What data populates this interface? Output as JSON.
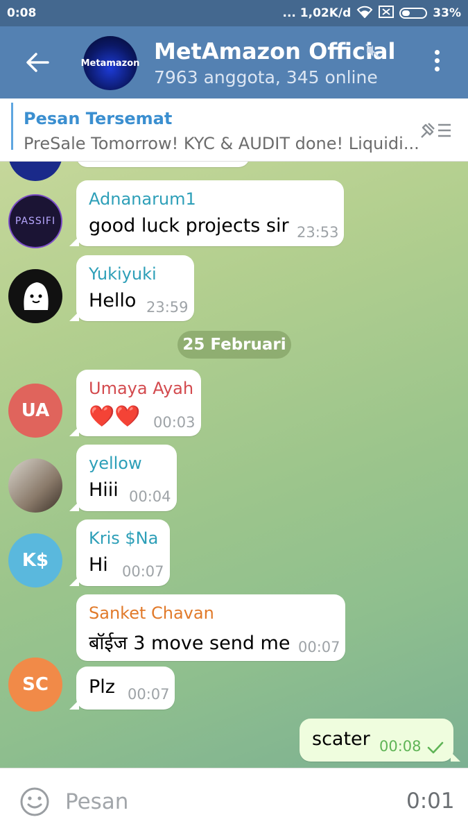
{
  "status_bar": {
    "time": "0:08",
    "network_speed": "... 1,02K/d",
    "battery_percent": "33%",
    "battery_level": 0.33
  },
  "header": {
    "title": "MetAmazon Official",
    "subtitle": "7963 anggota, 345 online",
    "avatar_text": "Metamazon",
    "muted": true
  },
  "pinned": {
    "title": "Pesan Tersemat",
    "text": "PreSale Tomorrow! KYC & AUDIT done! Liquidi..."
  },
  "date_separator": "25 Februari",
  "colors": {
    "header_bg": "#5481b2",
    "statusbar_bg": "#44688f",
    "pinned_title": "#3b8fd0",
    "outgoing_bubble": "#effdde",
    "check": "#5fb456"
  },
  "messages": [
    {
      "sender": "Adnanarum1",
      "sender_color": "#2d9fb8",
      "text": "good luck projects sir",
      "time": "23:53",
      "avatar_text": "PASSIFI"
    },
    {
      "sender": "Yukiyuki",
      "sender_color": "#2d9fb8",
      "text": "Hello",
      "time": "23:59",
      "avatar_text": ""
    },
    {
      "sender": "Umaya Ayah",
      "sender_color": "#d34a4e",
      "text": "❤️❤️",
      "time": "00:03",
      "avatar_text": "UA",
      "avatar_color": "#e0645c"
    },
    {
      "sender": "yellow",
      "sender_color": "#2d9fb8",
      "text": "Hiii",
      "time": "00:04",
      "avatar_text": ""
    },
    {
      "sender": "Kris $Na",
      "sender_color": "#2d9fb8",
      "text": "Hi",
      "time": "00:07",
      "avatar_text": "K$",
      "avatar_color": "#5ab8dd"
    },
    {
      "sender": "Sanket Chavan",
      "sender_color": "#e17a2a",
      "text": "बॉईज 3 move send me",
      "time": "00:07",
      "avatar_text": "SC",
      "avatar_color": "#f18a48"
    },
    {
      "sender": "",
      "text": "Plz",
      "time": "00:07"
    }
  ],
  "outgoing": {
    "text": "scater",
    "time": "00:08"
  },
  "input": {
    "placeholder": "Pesan",
    "record_time": "0:01"
  }
}
